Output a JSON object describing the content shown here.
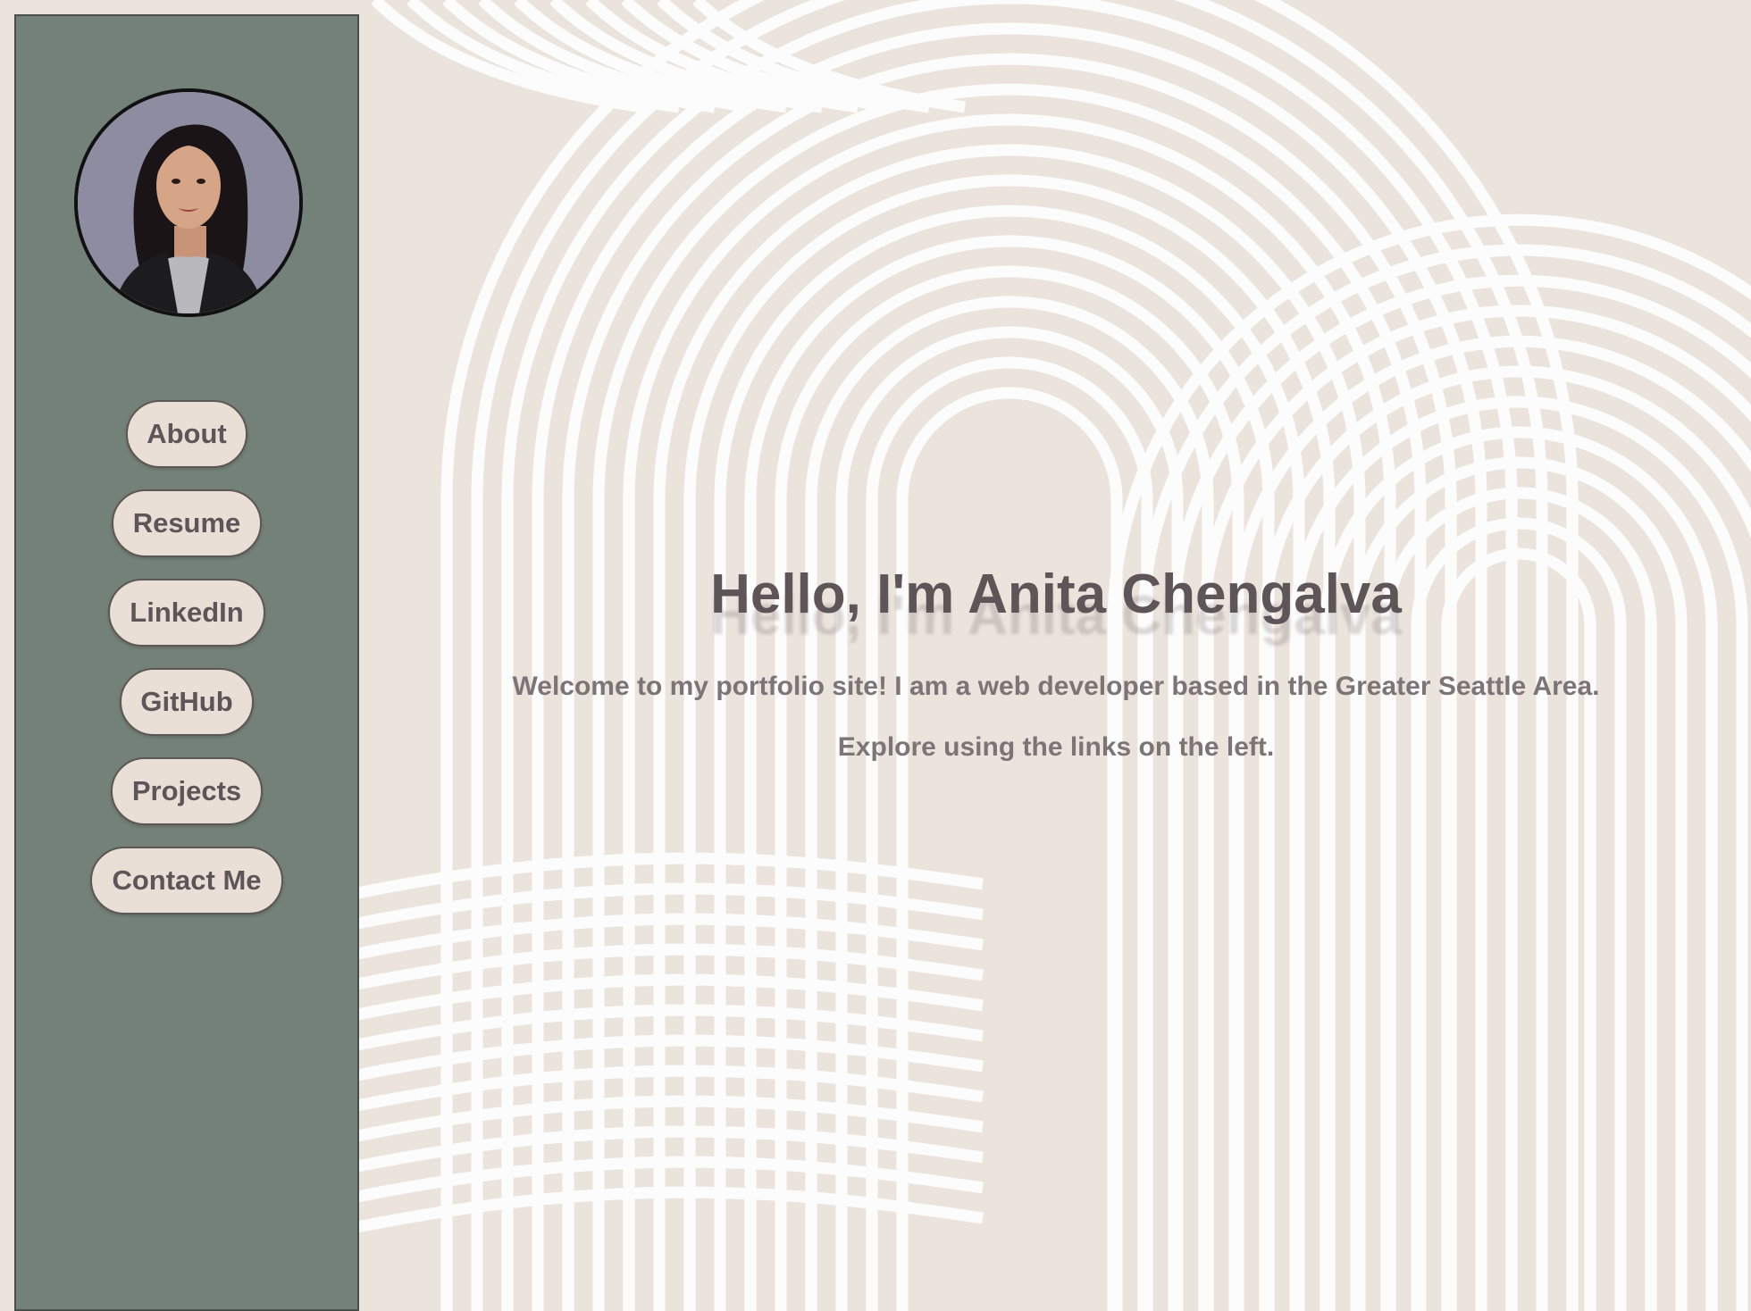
{
  "sidebar": {
    "avatar_alt": "Portrait of Anita Chengalva",
    "nav": [
      {
        "label": "About"
      },
      {
        "label": "Resume"
      },
      {
        "label": "LinkedIn"
      },
      {
        "label": "GitHub"
      },
      {
        "label": "Projects"
      },
      {
        "label": "Contact Me"
      }
    ]
  },
  "main": {
    "title": "Hello, I'm Anita Chengalva",
    "intro": "Welcome to my portfolio site! I am a web developer based in the Greater Seattle Area.",
    "hint": "Explore using the links on the left."
  },
  "colors": {
    "background": "#ebe4dd",
    "sidebar": "#738178",
    "button": "#e9dfd7",
    "text": "#5e5558"
  }
}
